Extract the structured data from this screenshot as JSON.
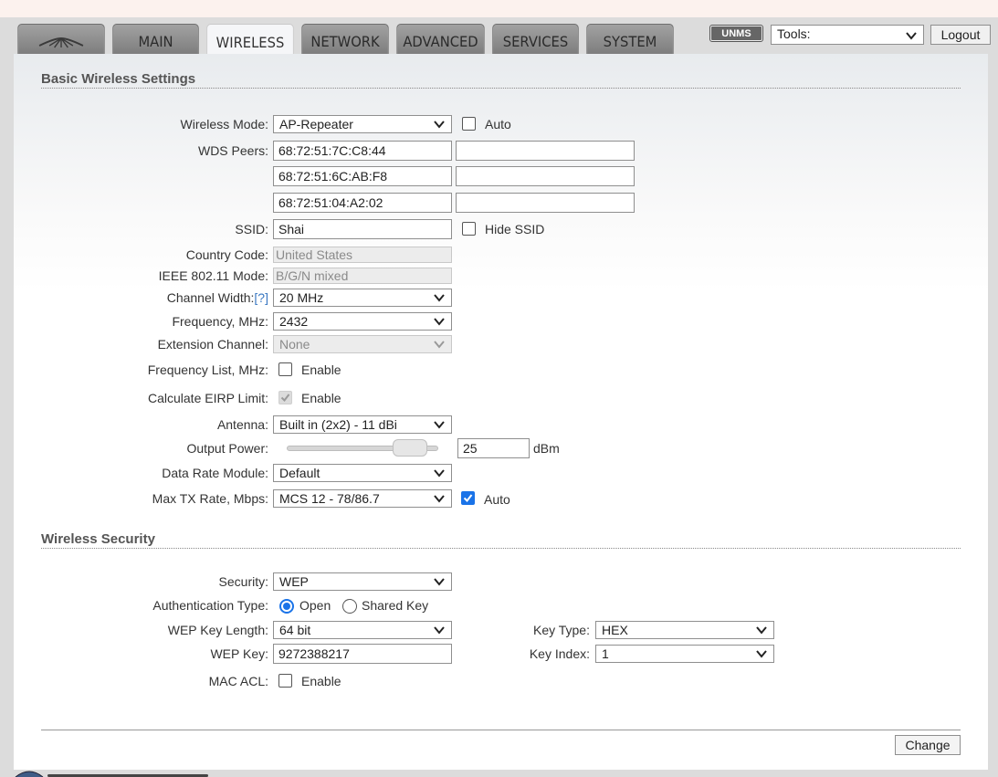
{
  "nav": {
    "tabs": [
      "MAIN",
      "WIRELESS",
      "NETWORK",
      "ADVANCED",
      "SERVICES",
      "SYSTEM"
    ],
    "active_tab": "WIRELESS"
  },
  "header": {
    "unms_badge": "UNMS",
    "tools_value": "Tools:",
    "logout_label": "Logout"
  },
  "basic": {
    "title": "Basic Wireless Settings",
    "wireless_mode": {
      "label": "Wireless Mode:",
      "value": "AP-Repeater",
      "auto_label": "Auto",
      "auto_checked": false
    },
    "wds_peers": {
      "label": "WDS Peers:",
      "values": [
        "68:72:51:7C:C8:44",
        "68:72:51:6C:AB:F8",
        "68:72:51:04:A2:02",
        "",
        "",
        ""
      ]
    },
    "ssid": {
      "label": "SSID:",
      "value": "Shai",
      "hide_label": "Hide SSID",
      "hide_checked": false
    },
    "country_code": {
      "label": "Country Code:",
      "value": "United States"
    },
    "ieee_mode": {
      "label": "IEEE 802.11 Mode:",
      "value": "B/G/N mixed"
    },
    "channel_width": {
      "label": "Channel Width:",
      "help": "[?]",
      "value": "20 MHz"
    },
    "frequency": {
      "label": "Frequency, MHz:",
      "value": "2432"
    },
    "extension_channel": {
      "label": "Extension Channel:",
      "value": "None"
    },
    "frequency_list": {
      "label": "Frequency List, MHz:",
      "enable_label": "Enable",
      "checked": false
    },
    "eirp_limit": {
      "label": "Calculate EIRP Limit:",
      "enable_label": "Enable",
      "checked": true
    },
    "antenna": {
      "label": "Antenna:",
      "value": "Built in (2x2) - 11 dBi"
    },
    "output_power": {
      "label": "Output Power:",
      "value": "25",
      "unit": "dBm",
      "slider_fraction": 0.85
    },
    "data_rate_module": {
      "label": "Data Rate Module:",
      "value": "Default"
    },
    "max_tx_rate": {
      "label": "Max TX Rate, Mbps:",
      "value": "MCS 12 - 78/86.7",
      "auto_label": "Auto",
      "auto_checked": true
    }
  },
  "security": {
    "title": "Wireless Security",
    "security": {
      "label": "Security:",
      "value": "WEP"
    },
    "auth_type": {
      "label": "Authentication Type:",
      "options": [
        "Open",
        "Shared Key"
      ],
      "selected": "Open"
    },
    "wep_key_length": {
      "label": "WEP Key Length:",
      "value": "64 bit"
    },
    "key_type": {
      "label": "Key Type:",
      "value": "HEX"
    },
    "wep_key": {
      "label": "WEP Key:",
      "value": "9272388217"
    },
    "key_index": {
      "label": "Key Index:",
      "value": "1"
    },
    "mac_acl": {
      "label": "MAC ACL:",
      "enable_label": "Enable",
      "checked": false
    }
  },
  "footer": {
    "change_label": "Change"
  },
  "colors": {
    "accent": "#1a73e8",
    "help_link": "#3a78c2",
    "tab_bg": "#8e8e8e"
  }
}
